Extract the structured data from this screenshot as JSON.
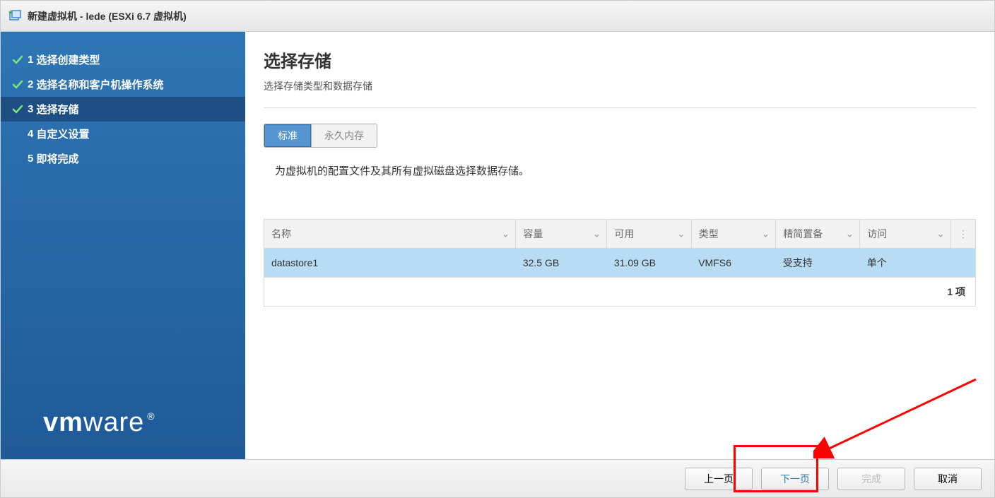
{
  "title": "新建虚拟机 - lede (ESXi 6.7 虚拟机)",
  "steps": [
    {
      "num": "1",
      "label": "选择创建类型",
      "state": "done"
    },
    {
      "num": "2",
      "label": "选择名称和客户机操作系统",
      "state": "done"
    },
    {
      "num": "3",
      "label": "选择存储",
      "state": "active"
    },
    {
      "num": "4",
      "label": "自定义设置",
      "state": "pending"
    },
    {
      "num": "5",
      "label": "即将完成",
      "state": "pending"
    }
  ],
  "main": {
    "heading": "选择存储",
    "subtitle": "选择存储类型和数据存储",
    "segments": {
      "standard": "标准",
      "pmem": "永久内存"
    },
    "hint": "为虚拟机的配置文件及其所有虚拟磁盘选择数据存储。",
    "columns": {
      "name": "名称",
      "capacity": "容量",
      "free": "可用",
      "type": "类型",
      "thin": "精简置备",
      "access": "访问"
    },
    "rows": [
      {
        "name": "datastore1",
        "capacity": "32.5 GB",
        "free": "31.09 GB",
        "type": "VMFS6",
        "thin": "受支持",
        "access": "单个"
      }
    ],
    "footer_count": "1 项"
  },
  "buttons": {
    "back": "上一页",
    "next": "下一页",
    "finish": "完成",
    "cancel": "取消"
  },
  "logo": "vmware"
}
